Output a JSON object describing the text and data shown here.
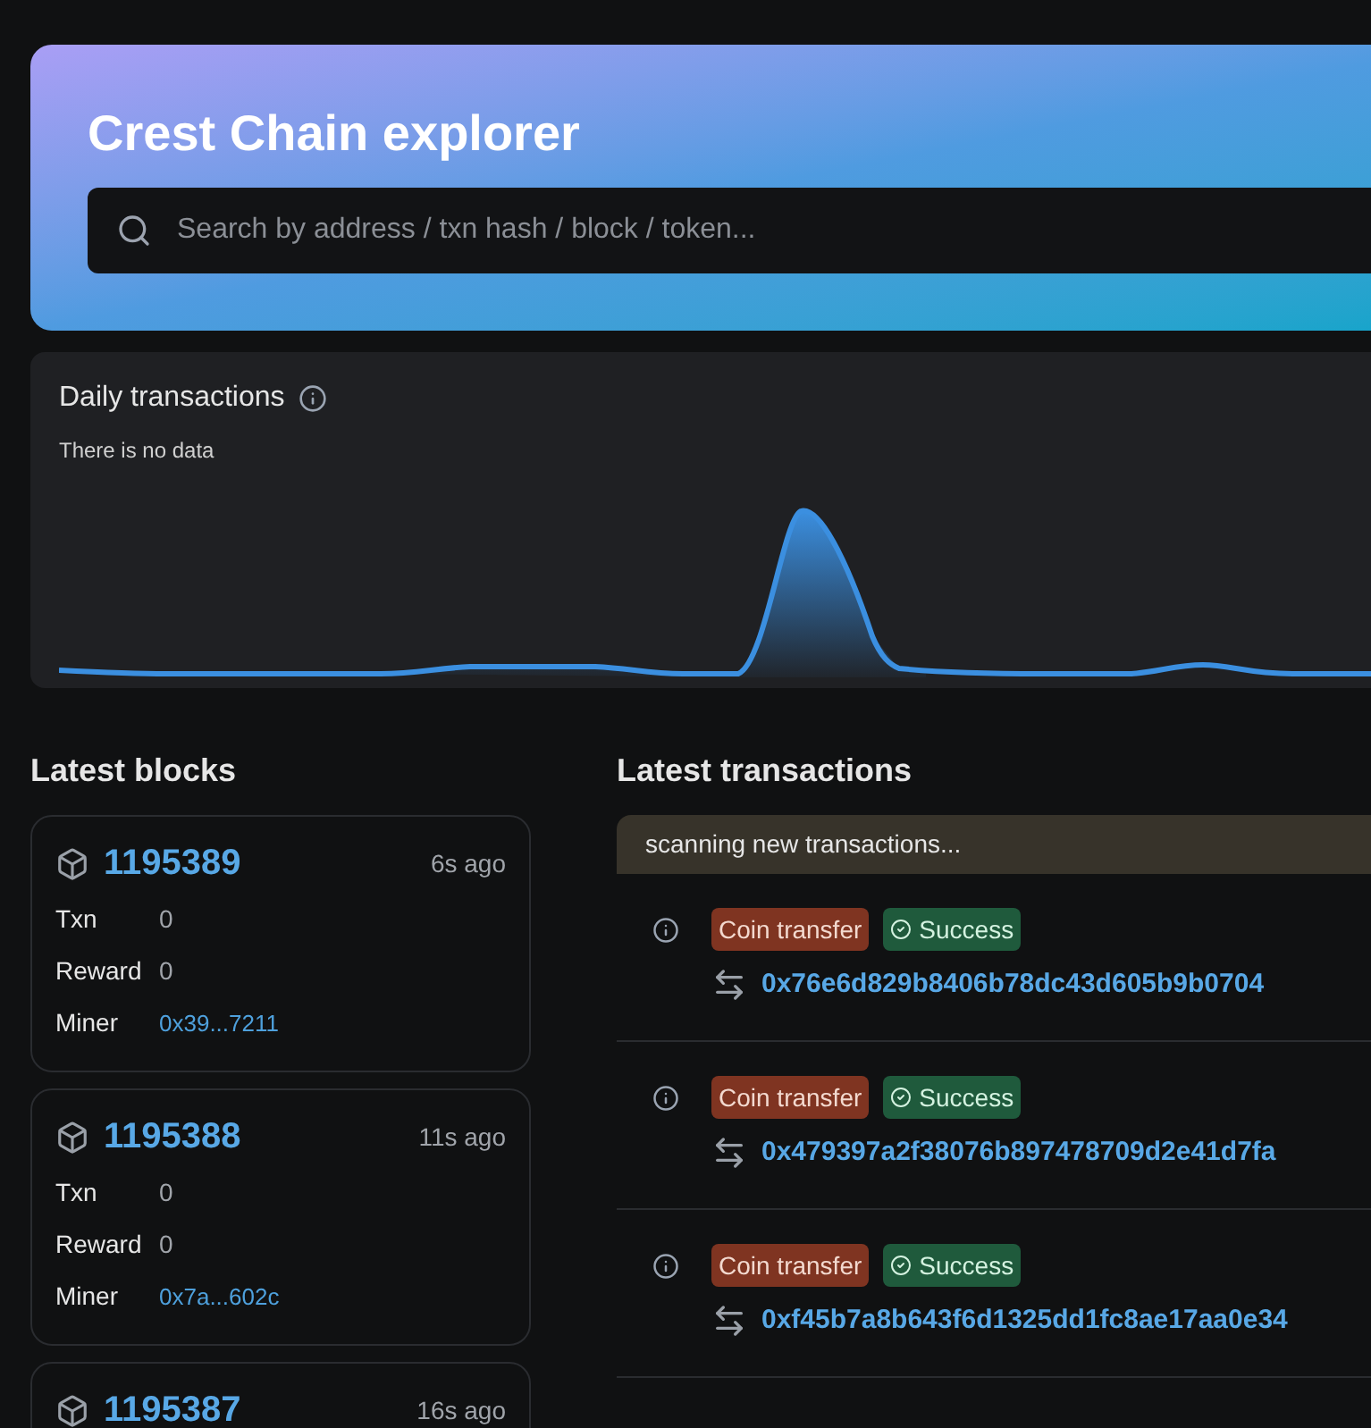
{
  "header": {
    "title": "Crest Chain explorer",
    "search": {
      "placeholder": "Search by address / txn hash / block / token..."
    }
  },
  "chart_panel": {
    "title": "Daily transactions",
    "message": "There is no data"
  },
  "latest_blocks": {
    "title": "Latest blocks",
    "blocks": [
      {
        "number": "1195389",
        "age": "6s ago",
        "fields": [
          {
            "label": "Txn",
            "value": "0",
            "kind": "text"
          },
          {
            "label": "Reward",
            "value": "0",
            "kind": "text"
          },
          {
            "label": "Miner",
            "value": "0x39...7211",
            "kind": "link"
          }
        ]
      },
      {
        "number": "1195388",
        "age": "11s ago",
        "fields": [
          {
            "label": "Txn",
            "value": "0",
            "kind": "text"
          },
          {
            "label": "Reward",
            "value": "0",
            "kind": "text"
          },
          {
            "label": "Miner",
            "value": "0x7a...602c",
            "kind": "link"
          }
        ]
      },
      {
        "number": "1195387",
        "age": "16s ago"
      }
    ]
  },
  "latest_transactions": {
    "title": "Latest transactions",
    "banner": "scanning new transactions...",
    "rows": [
      {
        "type": "Coin transfer",
        "status": "Success",
        "hash": "0x76e6d829b8406b78dc43d605b9b0704"
      },
      {
        "type": "Coin transfer",
        "status": "Success",
        "hash": "0x479397a2f38076b897478709d2e41d7fa"
      },
      {
        "type": "Coin transfer",
        "status": "Success",
        "hash": "0xf45b7a8b643f6d1325dd1fc8ae17aa0e34"
      }
    ]
  }
}
